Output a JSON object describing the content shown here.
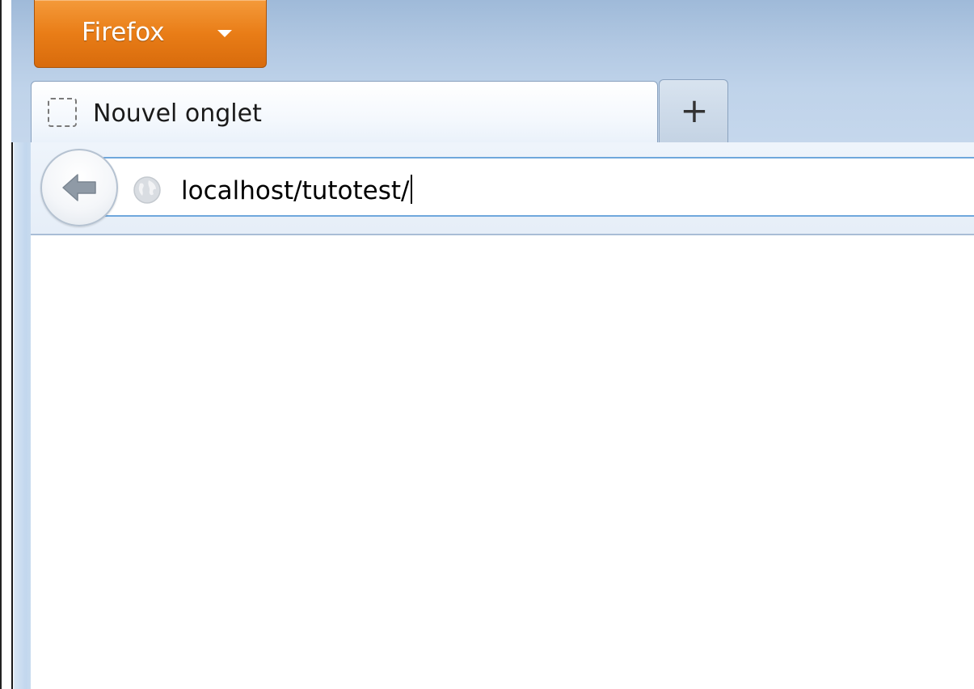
{
  "app_button": {
    "label": "Firefox",
    "accent": "#e97d17"
  },
  "tabs": [
    {
      "label": "Nouvel onglet",
      "icon": "blank-page-icon",
      "active": true
    }
  ],
  "new_tab": {
    "label": "+"
  },
  "navbar": {
    "back_icon": "back-arrow-icon",
    "site_icon": "globe-icon",
    "url_value": "localhost/tutotest/"
  }
}
